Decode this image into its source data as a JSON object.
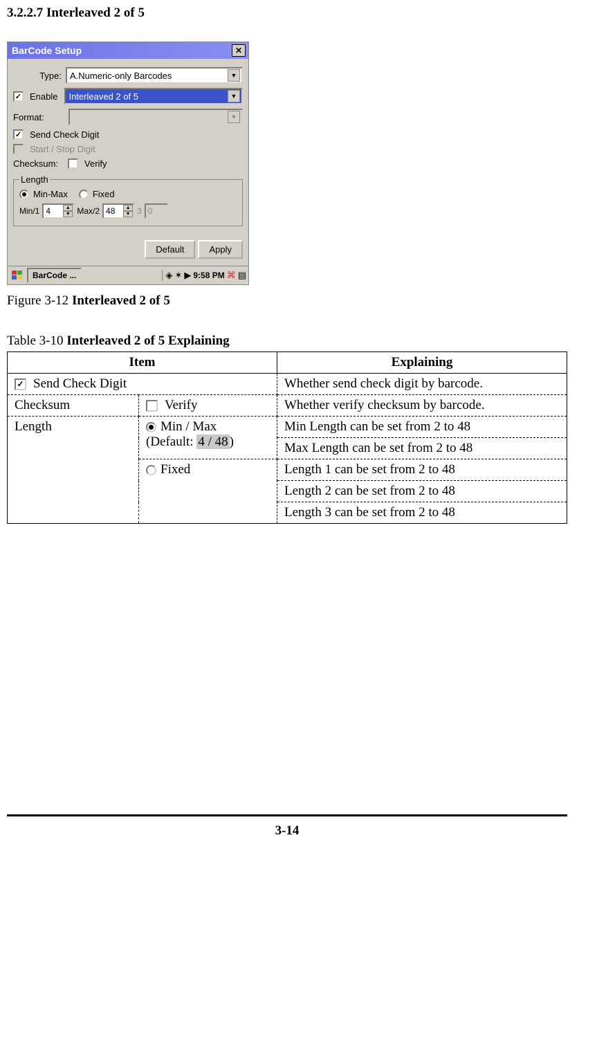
{
  "heading": "3.2.2.7 Interleaved 2 of 5",
  "window": {
    "title": "BarCode Setup",
    "type_label": "Type:",
    "type_value": "A.Numeric-only Barcodes",
    "enable_label": "Enable",
    "enable_checked": "✓",
    "enable_value": "Interleaved 2 of 5",
    "format_label": "Format:",
    "format_value": "",
    "send_check_checked": "✓",
    "send_check_label": "Send Check Digit",
    "start_stop_label": "Start / Stop Digit",
    "checksum_label": "Checksum:",
    "verify_label": "Verify",
    "length_legend": "Length",
    "minmax_label": "Min-Max",
    "fixed_label": "Fixed",
    "min_label": "Min/1",
    "min_value": "4",
    "max_label": "Max/2",
    "max_value": "48",
    "three_label": "3",
    "three_value": "0",
    "default_btn": "Default",
    "apply_btn": "Apply",
    "taskbar_app": "BarCode ...",
    "taskbar_time": "9:58 PM"
  },
  "figure_caption_prefix": "Figure 3-12 ",
  "figure_caption_bold": "Interleaved 2 of 5",
  "table_caption_prefix": "Table 3-10 ",
  "table_caption_bold": "Interleaved 2 of 5 Explaining",
  "table": {
    "header_item": "Item",
    "header_explain": "Explaining",
    "row1_item": "Send Check Digit",
    "row1_explain": "Whether send check digit by barcode.",
    "row2_item_a": "Checksum",
    "row2_item_b": "Verify",
    "row2_explain": "Whether verify checksum by barcode.",
    "length_label": "Length",
    "minmax_item_a": "Min / Max",
    "minmax_item_b": "(Default: ",
    "minmax_item_hl": "4 / 48",
    "minmax_item_c": ")",
    "minmax_explain1": "Min Length can be set from 2 to 48",
    "minmax_explain2": "Max Length can be set from 2 to 48",
    "fixed_item": "Fixed",
    "fixed_explain1": "Length 1 can be set from 2 to 48",
    "fixed_explain2": "Length 2 can be set from 2 to 48",
    "fixed_explain3": "Length 3 can be set from 2 to 48"
  },
  "page_number": "3-14"
}
